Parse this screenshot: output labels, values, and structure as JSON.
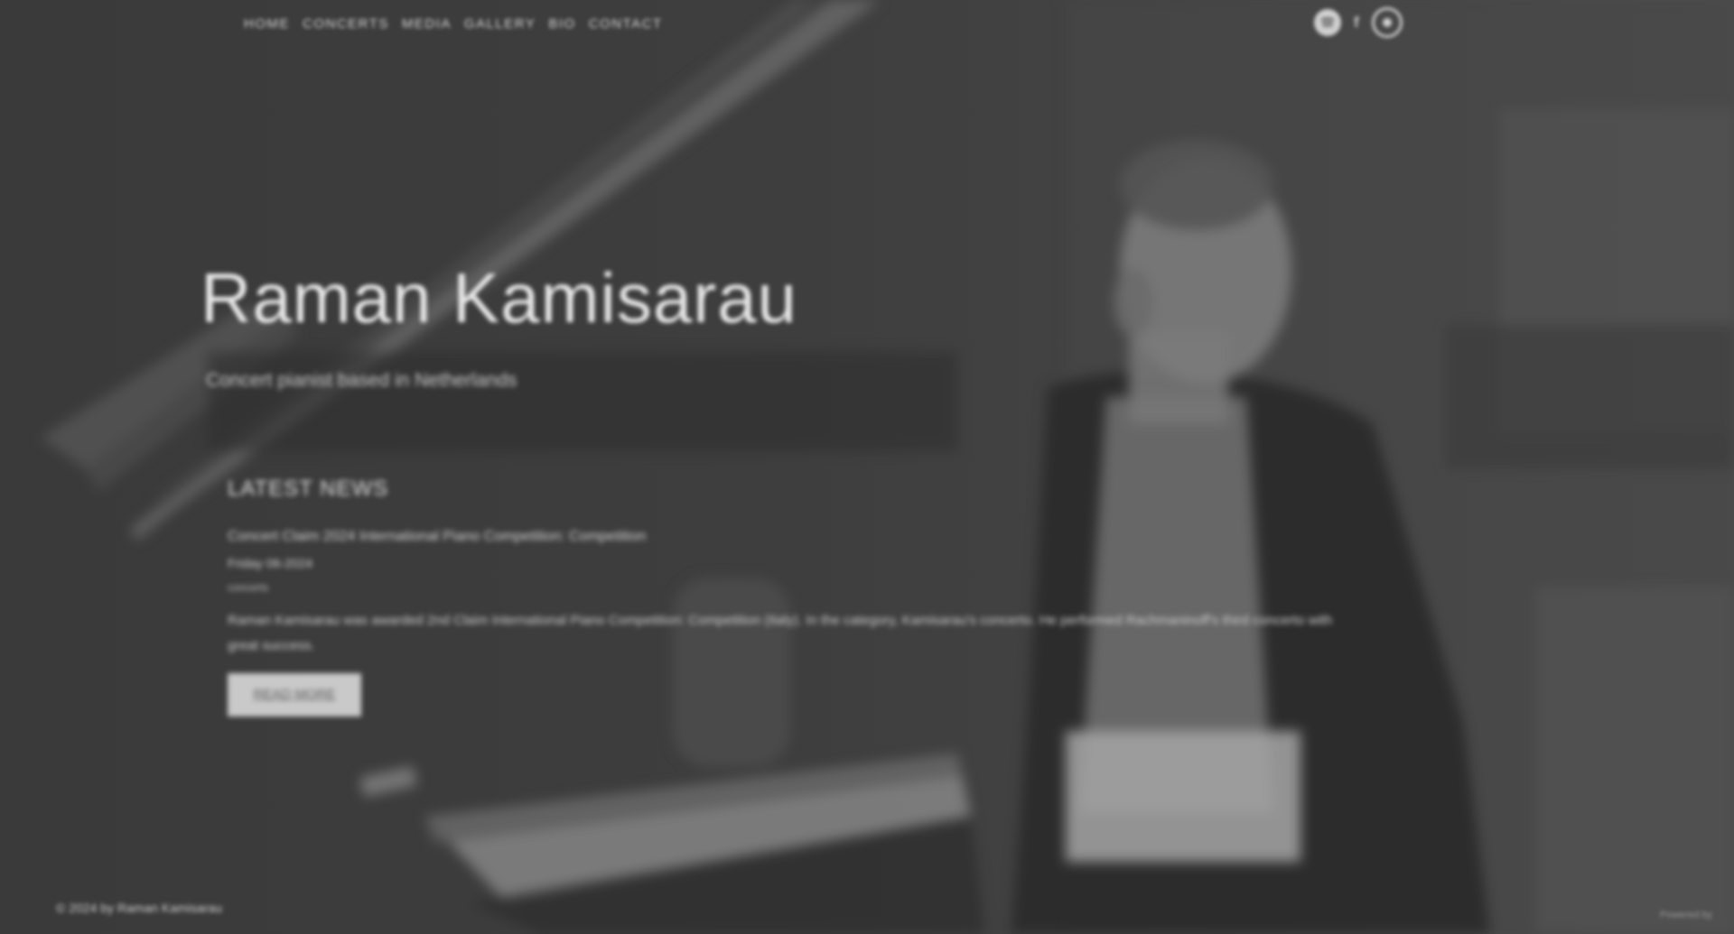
{
  "nav": {
    "items": [
      "HOME",
      "CONCERTS",
      "MEDIA",
      "GALLERY",
      "BIO",
      "CONTACT"
    ]
  },
  "social": {
    "icons": [
      "spotify-icon",
      "facebook-icon",
      "instagram-icon"
    ],
    "facebook_glyph": "f"
  },
  "hero": {
    "title": "Raman Kamisarau",
    "subtitle": "Concert pianist based in Netherlands"
  },
  "news": {
    "heading": "LATEST NEWS",
    "item_title": "Concert Claim 2024 International Piano Competition: Competition",
    "item_date": "Friday 06-2024",
    "item_category": "concerts",
    "item_body": "Raman Kamisarau was awarded 2nd Claim International Piano Competition: Competition (Italy). In the category, Kamisarau's concerto. He performed Rachmaninoff's third concerto with great success.",
    "read_more": "READ MORE"
  },
  "footer": {
    "copyright": "© 2024 by Raman Kamisarau",
    "credit": "Powered by"
  },
  "colors": {
    "background": "#3c3c3c",
    "text": "#e6e6e6",
    "button": "#c9c9c9"
  }
}
